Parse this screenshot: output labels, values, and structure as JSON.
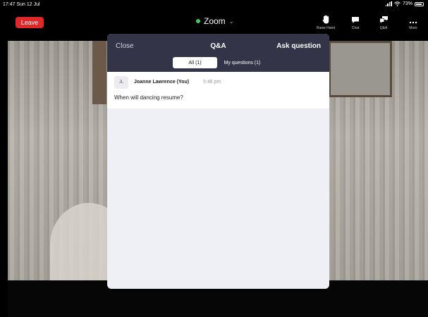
{
  "status_bar": {
    "time": "17:47  Sun 12 Jul",
    "battery": "73%"
  },
  "toolbar": {
    "leave_label": "Leave",
    "meeting_title": "Zoom",
    "buttons": [
      {
        "label": "Raise Hand",
        "icon": "raise-hand-icon"
      },
      {
        "label": "Chat",
        "icon": "chat-icon"
      },
      {
        "label": "Q&A",
        "icon": "qa-icon"
      },
      {
        "label": "More",
        "icon": "more-icon"
      }
    ]
  },
  "qa": {
    "close_label": "Close",
    "title": "Q&A",
    "ask_label": "Ask question",
    "tabs": [
      {
        "label": "All (1)",
        "selected": true
      },
      {
        "label": "My questions (1)",
        "selected": false
      }
    ],
    "questions": [
      {
        "initials": "JL",
        "author": "Joanne Lawrence (You)",
        "time": "5:46 pm",
        "text": "When will dancing resume?"
      }
    ]
  },
  "colors": {
    "leave": "#e02828",
    "panel_header": "#333447",
    "status_dot": "#3ecf5a"
  }
}
